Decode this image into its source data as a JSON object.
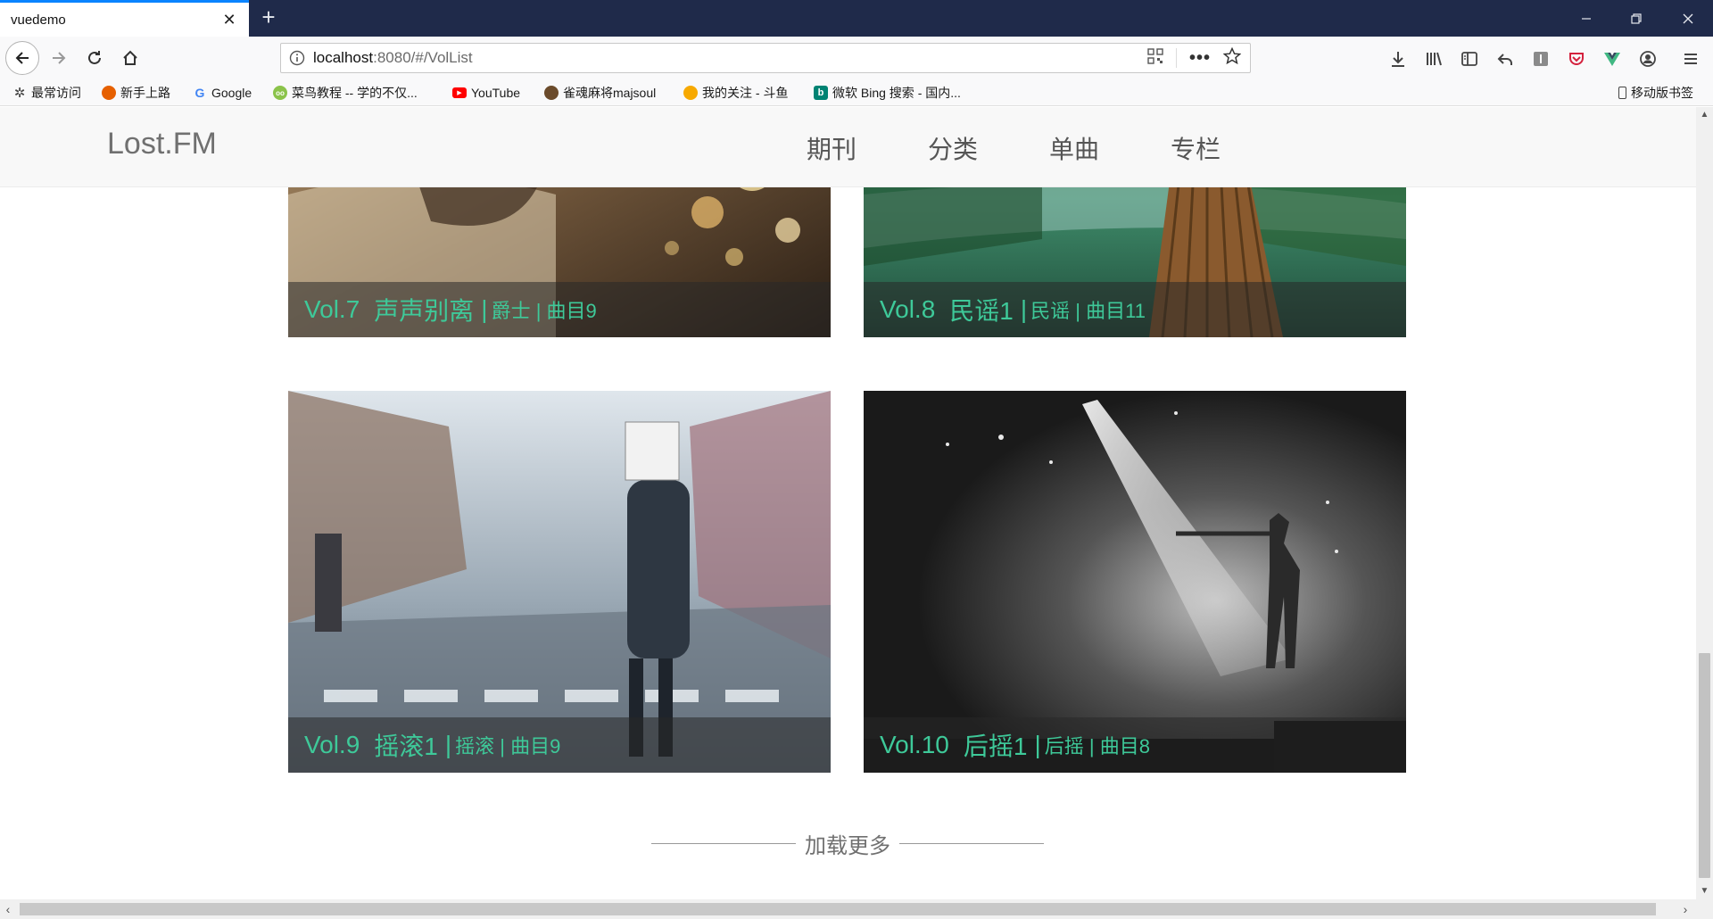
{
  "browser": {
    "tab_title": "vuedemo",
    "url_host": "localhost",
    "url_rest": ":8080/#/VolList",
    "bookmarks": [
      {
        "label": "最常访问",
        "icon": "gear-icon",
        "color": "#555555"
      },
      {
        "label": "新手上路",
        "icon": "firefox-icon",
        "color": "#e66000"
      },
      {
        "label": "Google",
        "icon": "google-icon",
        "color": "#4285f4"
      },
      {
        "label": "菜鸟教程 -- 学的不仅...",
        "icon": "runoob-icon",
        "color": "#8bc34a"
      },
      {
        "label": "YouTube",
        "icon": "youtube-icon",
        "color": "#ff0000"
      },
      {
        "label": "雀魂麻将majsoul",
        "icon": "majsoul-icon",
        "color": "#6b4b2b"
      },
      {
        "label": "我的关注 - 斗鱼",
        "icon": "douyu-icon",
        "color": "#f7a900"
      },
      {
        "label": "微软 Bing 搜索 - 国内...",
        "icon": "bing-icon",
        "color": "#008373"
      }
    ],
    "mobile_bookmarks": "移动版书签"
  },
  "site": {
    "logo": "Lost.FM",
    "menu": [
      "期刊",
      "分类",
      "单曲",
      "专栏"
    ],
    "accent_color": "#3ec999",
    "cards": [
      {
        "vol": "Vol.7",
        "title": "声声别离",
        "category": "爵士",
        "tracks": "曲目9",
        "image": "rain-splash-photo"
      },
      {
        "vol": "Vol.8",
        "title": "民谣1",
        "category": "民谣",
        "tracks": "曲目11",
        "image": "bamboo-raft-river-photo"
      },
      {
        "vol": "Vol.9",
        "title": "摇滚1",
        "category": "摇滚",
        "tracks": "曲目9",
        "image": "street-crossing-photo"
      },
      {
        "vol": "Vol.10",
        "title": "后摇1",
        "category": "后摇",
        "tracks": "曲目8",
        "image": "concert-stage-photo"
      }
    ],
    "load_more": "加载更多"
  }
}
